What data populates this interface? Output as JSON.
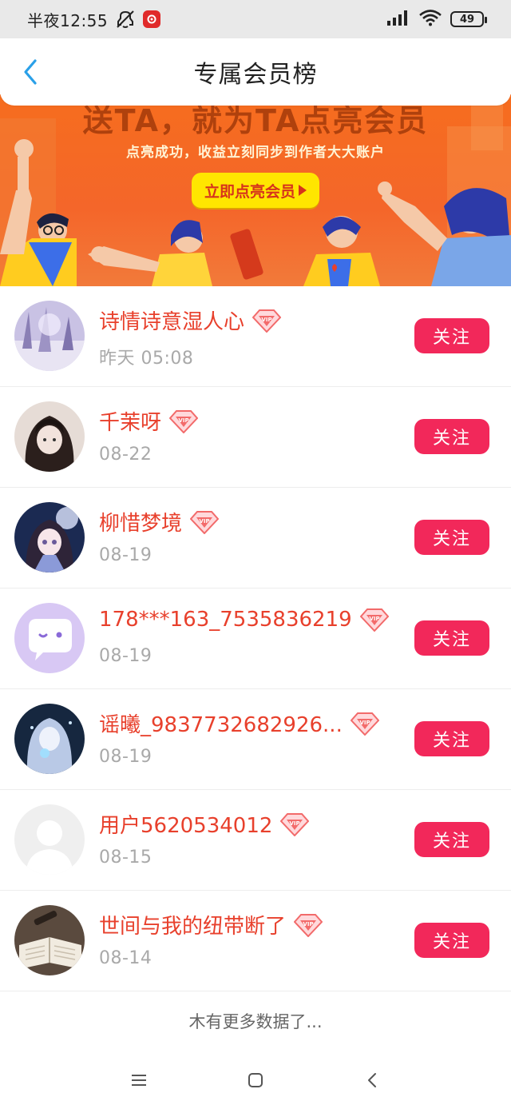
{
  "status_bar": {
    "time": "半夜12:55",
    "battery": "49"
  },
  "header": {
    "title": "专属会员榜"
  },
  "banner": {
    "headline": "送TA，就为TA点亮会员",
    "subtitle": "点亮成功，收益立刻同步到作者大大账户",
    "cta_label": "立即点亮会员"
  },
  "members": [
    {
      "name": "诗情诗意湿人心",
      "date": "昨天 05:08",
      "follow_label": "关注",
      "vip": "VIP"
    },
    {
      "name": "千茉呀",
      "date": "08-22",
      "follow_label": "关注",
      "vip": "VIP"
    },
    {
      "name": "柳惜梦境",
      "date": "08-19",
      "follow_label": "关注",
      "vip": "VIP"
    },
    {
      "name": "178***163_7535836219",
      "date": "08-19",
      "follow_label": "关注",
      "vip": "VIP"
    },
    {
      "name": "谣曦_9837732682926...",
      "date": "08-19",
      "follow_label": "关注",
      "vip": "VIP"
    },
    {
      "name": "用户5620534012",
      "date": "08-15",
      "follow_label": "关注",
      "vip": "VIP"
    },
    {
      "name": "世间与我的纽带断了",
      "date": "08-14",
      "follow_label": "关注",
      "vip": "VIP"
    }
  ],
  "footer": {
    "text": "木有更多数据了..."
  },
  "icons": {
    "back": "chevron-left-icon",
    "vip": "vip-diamond-icon",
    "menu": "menu-icon",
    "home": "home-square-icon",
    "nav_back": "nav-back-icon"
  },
  "colors": {
    "accent": "#f2285a",
    "name": "#e8402c",
    "back_icon": "#2aa0e8",
    "banner": "#f66d1e",
    "cta": "#ffe600"
  }
}
